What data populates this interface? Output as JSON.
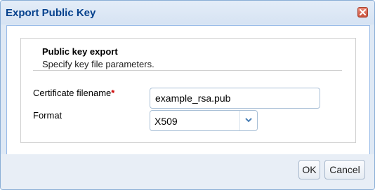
{
  "dialog": {
    "title": "Export Public Key",
    "close_icon": "close-icon"
  },
  "panel": {
    "heading": "Public key export",
    "subheading": "Specify key file parameters."
  },
  "form": {
    "filename": {
      "label": "Certificate filename",
      "required_mark": "*",
      "value": "example_rsa.pub"
    },
    "format": {
      "label": "Format",
      "selected": "X509",
      "arrow_icon": "chevron-down-icon"
    }
  },
  "buttons": {
    "ok": "OK",
    "cancel": "Cancel"
  },
  "colors": {
    "title_text": "#04408c",
    "required_mark": "#cc0000",
    "close_button": "#c9503a"
  }
}
